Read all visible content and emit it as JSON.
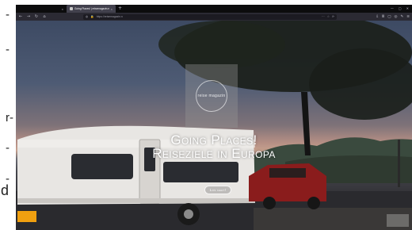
{
  "left_strip": {
    "fragments": [
      "-",
      "-",
      "r-",
      "-",
      "-",
      "d"
    ]
  },
  "browser": {
    "tabs": [
      {
        "label": "×",
        "active": false
      },
      {
        "label": "Going Places! | reisemagazin.n",
        "active": true
      }
    ],
    "new_tab_label": "+",
    "nav": {
      "back": "←",
      "forward": "→",
      "reload": "↻",
      "home": "⌂"
    },
    "url": "https://reisemagazin.n",
    "url_icons": {
      "shield": "◍",
      "lock": "🔒"
    },
    "right_tools": [
      "⋯",
      "☆",
      "⟳",
      "⇩",
      "Ⅲ",
      "▢",
      "◎",
      "✎",
      "≡"
    ],
    "window_controls": [
      "—",
      "▢",
      "✕"
    ]
  },
  "hero": {
    "logo_text": "reise magazin",
    "headline_line1": "Going Places!",
    "headline_line2": "Reiseziele in Europa",
    "cta_label": "Los geht!"
  },
  "colors": {
    "tabbar": "#0c0c0d",
    "navbar": "#2b2a33",
    "active_tab": "#42414d"
  }
}
